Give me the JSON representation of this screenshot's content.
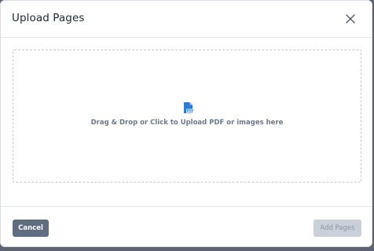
{
  "dialog": {
    "title": "Upload Pages",
    "close_icon": "close-icon"
  },
  "dropzone": {
    "icon": "pdf-file-icon",
    "icon_label": "PDF",
    "text": "Drag & Drop or Click to Upload PDF or images here"
  },
  "footer": {
    "cancel_label": "Cancel",
    "add_label": "Add Pages",
    "add_disabled": true
  },
  "colors": {
    "accent": "#2b7bd6",
    "cancel_bg": "#5e6e80",
    "disabled_bg": "#c9d0d9"
  }
}
